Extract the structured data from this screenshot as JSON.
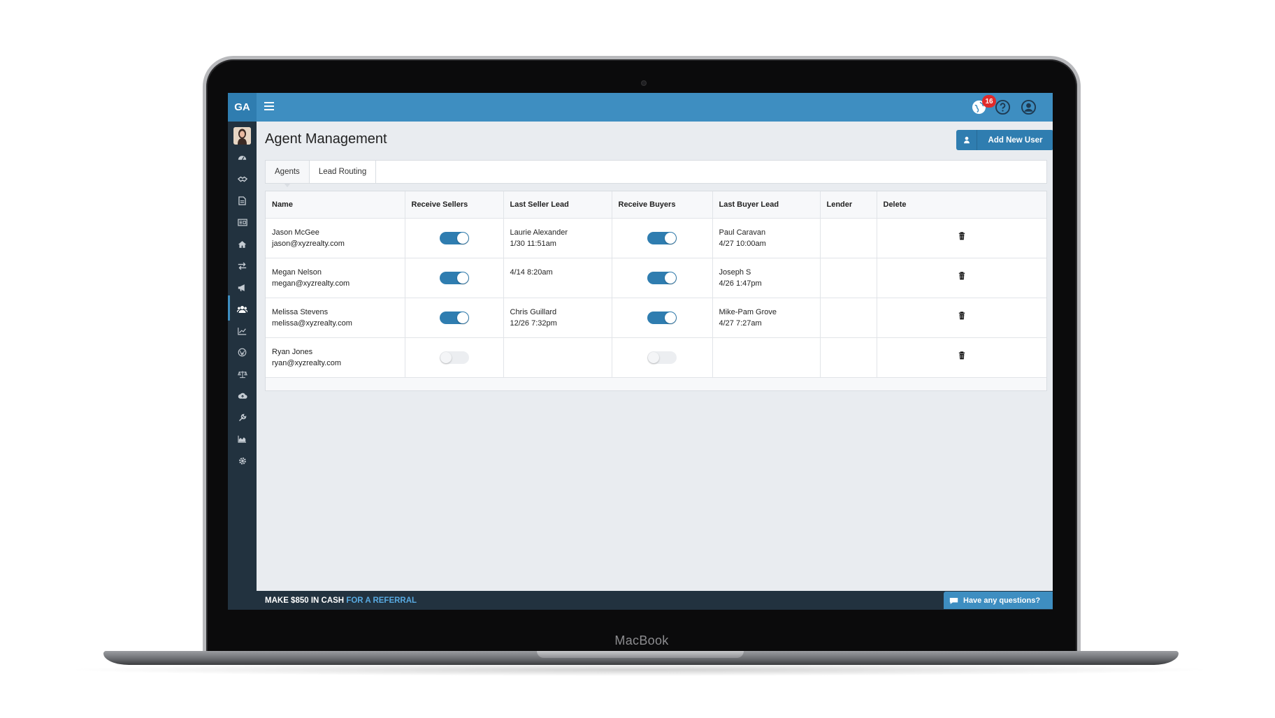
{
  "device": {
    "brand": "MacBook"
  },
  "topbar": {
    "logo": "GA",
    "notification_count": "16"
  },
  "page": {
    "title": "Agent Management",
    "add_button_label": "Add New User"
  },
  "tabs": [
    {
      "label": "Agents",
      "active": true
    },
    {
      "label": "Lead Routing",
      "active": false
    }
  ],
  "table": {
    "columns": [
      "Name",
      "Receive Sellers",
      "Last Seller Lead",
      "Receive Buyers",
      "Last Buyer Lead",
      "Lender",
      "Delete"
    ],
    "rows": [
      {
        "name": "Jason McGee",
        "email": "jason@xyzrealty.com",
        "receive_sellers": true,
        "seller_lead_name": "Laurie Alexander",
        "seller_lead_time": "1/30 11:51am",
        "receive_buyers": true,
        "buyer_lead_name": "Paul Caravan",
        "buyer_lead_time": "4/27 10:00am",
        "lender": ""
      },
      {
        "name": "Megan Nelson",
        "email": "megan@xyzrealty.com",
        "receive_sellers": true,
        "seller_lead_name": "4/14 8:20am",
        "seller_lead_time": "",
        "receive_buyers": true,
        "buyer_lead_name": "Joseph S",
        "buyer_lead_time": "4/26 1:47pm",
        "lender": ""
      },
      {
        "name": "Melissa Stevens",
        "email": "melissa@xyzrealty.com",
        "receive_sellers": true,
        "seller_lead_name": "Chris Guillard",
        "seller_lead_time": "12/26 7:32pm",
        "receive_buyers": true,
        "buyer_lead_name": "Mike-Pam Grove",
        "buyer_lead_time": "4/27 7:27am",
        "lender": ""
      },
      {
        "name": "Ryan Jones",
        "email": "ryan@xyzrealty.com",
        "receive_sellers": false,
        "seller_lead_name": "",
        "seller_lead_time": "",
        "receive_buyers": false,
        "buyer_lead_name": "",
        "buyer_lead_time": "",
        "lender": ""
      }
    ]
  },
  "footer": {
    "promo_main": "MAKE $850 IN CASH",
    "promo_accent": "FOR A REFERRAL",
    "chat_label": "Have any questions?"
  },
  "sidebar_icons": [
    "dashboard-icon",
    "handshake-icon",
    "document-icon",
    "id-card-icon",
    "home-icon",
    "transfer-icon",
    "megaphone-icon",
    "users-icon",
    "line-chart-icon",
    "wordpress-icon",
    "scales-icon",
    "cloud-upload-icon",
    "wrench-icon",
    "area-chart-icon",
    "gear-icon"
  ],
  "colors": {
    "primary": "#3e8ec1",
    "sidebar": "#22323f",
    "background": "#e9ecf0",
    "badge": "#e02b2b"
  }
}
